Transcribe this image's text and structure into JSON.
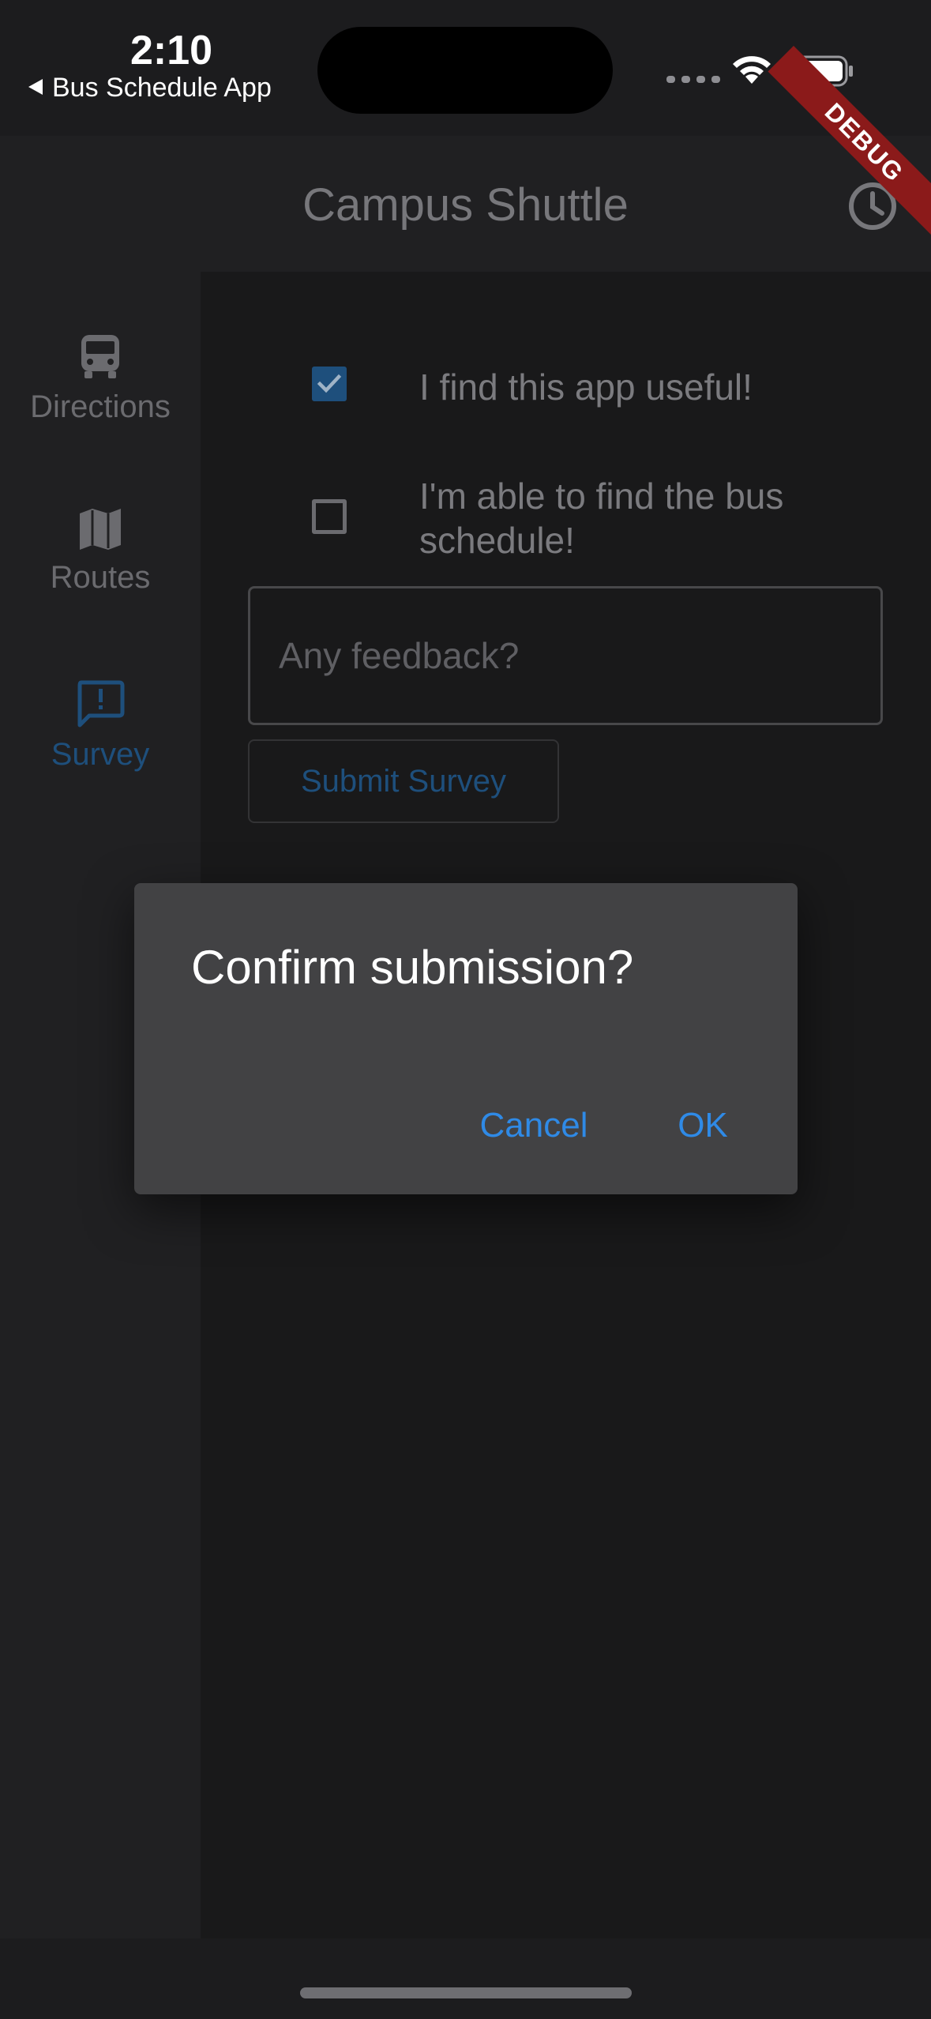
{
  "status_bar": {
    "time": "2:10",
    "back_app": "Bus Schedule App"
  },
  "debug_banner": "DEBUG",
  "app_bar": {
    "title": "Campus Shuttle",
    "action_icon": "history-clock-icon"
  },
  "nav_rail": {
    "items": [
      {
        "label": "Directions",
        "icon": "bus-icon",
        "active": false
      },
      {
        "label": "Routes",
        "icon": "map-icon",
        "active": false
      },
      {
        "label": "Survey",
        "icon": "feedback-icon",
        "active": true
      }
    ]
  },
  "survey": {
    "checkboxes": [
      {
        "label": "I find this app useful!",
        "checked": true
      },
      {
        "label_line1": "I'm able to find the bus",
        "label_line2": "schedule!",
        "checked": false
      }
    ],
    "feedback_placeholder": "Any feedback?",
    "submit_label": "Submit Survey"
  },
  "dialog": {
    "title": "Confirm submission?",
    "cancel_label": "Cancel",
    "ok_label": "OK"
  },
  "colors": {
    "accent": "#2f8ae6",
    "accent_dimmed": "#1e4f7c",
    "debug_banner": "#8b1a1a"
  }
}
